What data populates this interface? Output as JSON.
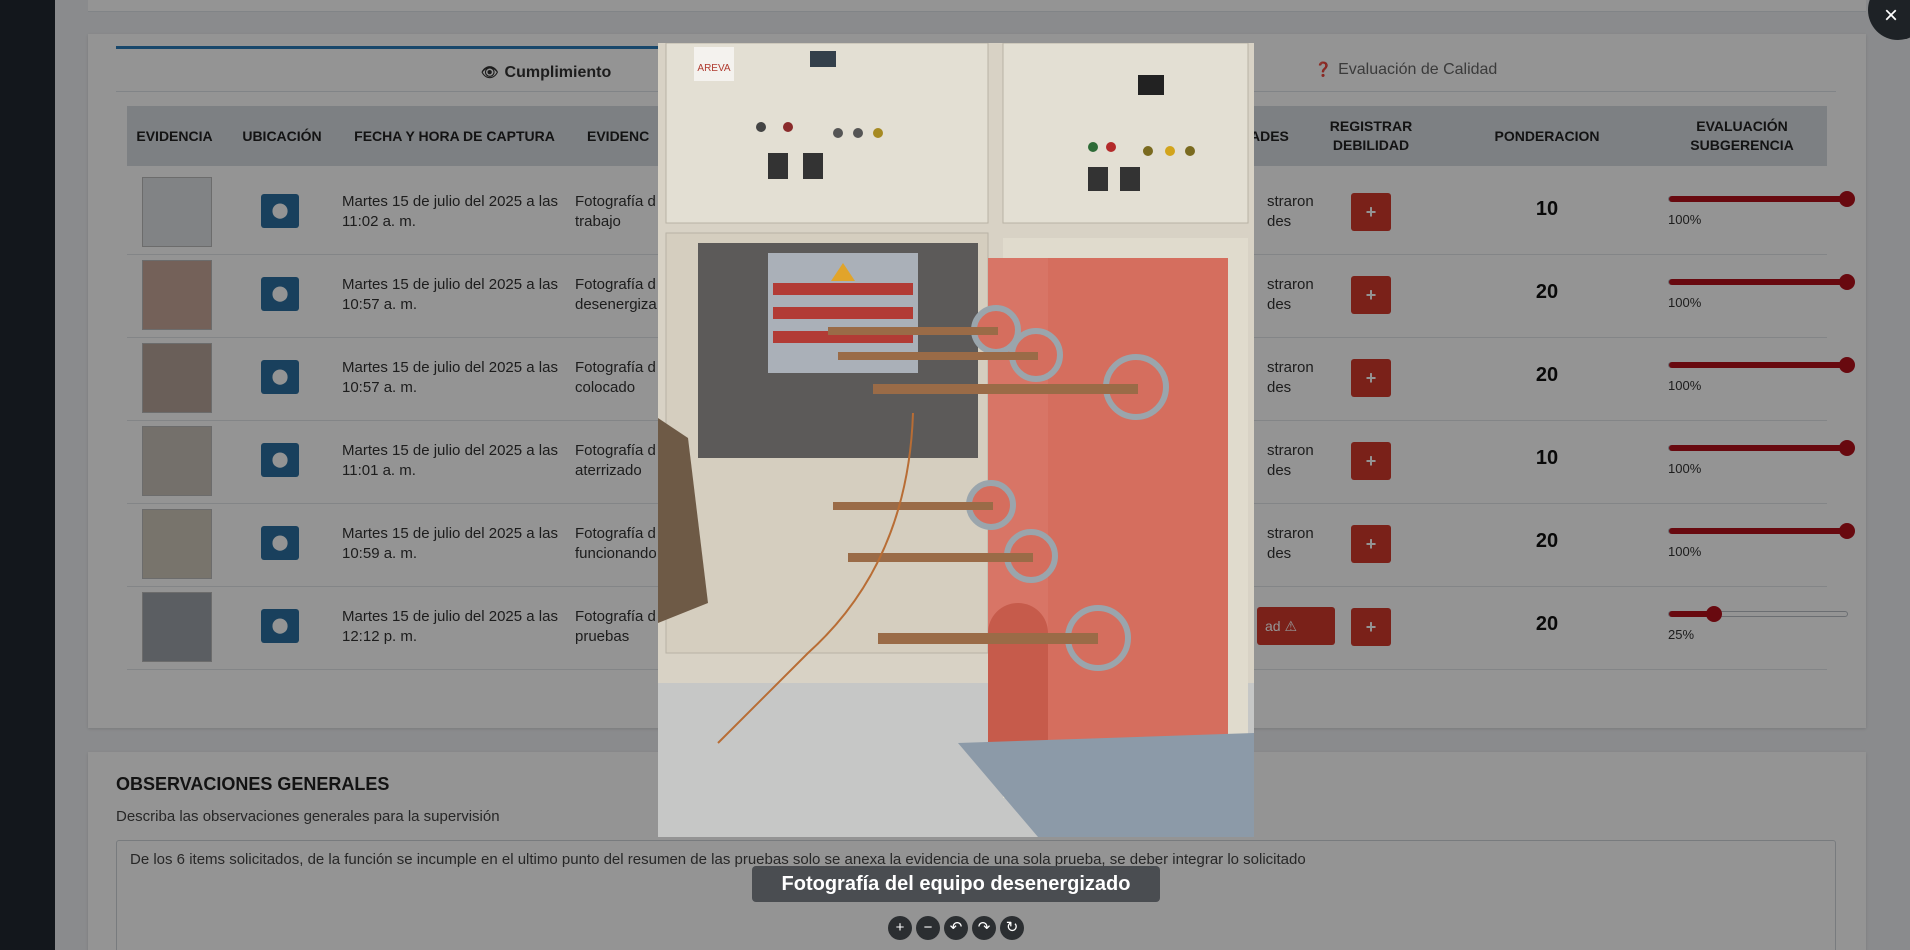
{
  "tabs": {
    "compliance": "Cumplimiento",
    "quality": "Evaluación de Calidad"
  },
  "table": {
    "headers": {
      "evidence": "EVIDENCIA",
      "location": "UBICACIÓN",
      "datetime": "FECHA Y HORA DE CAPTURA",
      "evidence_desc": "EVIDENC",
      "weaknesses": "ADES",
      "register": "REGISTRAR DEBILIDAD",
      "weight": "PONDERACION",
      "eval": "EVALUACIÓN SUBGERENCIA"
    },
    "rows": [
      {
        "date": "Martes 15 de julio del 2025 a las 11:02 a. m.",
        "desc1": "Fotografía d",
        "desc2": "trabajo",
        "cmt1": "straron",
        "cmt2": "des",
        "weight": "10",
        "value": 100,
        "pct": "100%"
      },
      {
        "date": "Martes 15 de julio del 2025 a las 10:57 a. m.",
        "desc1": "Fotografía d",
        "desc2": "desenergiza",
        "cmt1": "straron",
        "cmt2": "des",
        "weight": "20",
        "value": 100,
        "pct": "100%"
      },
      {
        "date": "Martes 15 de julio del 2025 a las 10:57 a. m.",
        "desc1": "Fotografía d",
        "desc2": "colocado",
        "cmt1": "straron",
        "cmt2": "des",
        "weight": "20",
        "value": 100,
        "pct": "100%"
      },
      {
        "date": "Martes 15 de julio del 2025 a las 11:01 a. m.",
        "desc1": "Fotografía d",
        "desc2": "aterrizado",
        "cmt1": "straron",
        "cmt2": "des",
        "weight": "10",
        "value": 100,
        "pct": "100%"
      },
      {
        "date": "Martes 15 de julio del 2025 a las 10:59 a. m.",
        "desc1": "Fotografía d",
        "desc2": "funcionando",
        "cmt1": "straron",
        "cmt2": "des",
        "weight": "20",
        "value": 100,
        "pct": "100%"
      },
      {
        "date": "Martes 15 de julio del 2025 a las 12:12 p. m.",
        "desc1": "Fotografía d",
        "desc2": "pruebas",
        "warn": "ad",
        "weight": "20",
        "value": 25,
        "pct": "25%"
      }
    ]
  },
  "observations": {
    "title": "OBSERVACIONES GENERALES",
    "subtitle": "Describa las observaciones generales para la supervisión",
    "text": "De los 6 items solicitados, de la función se incumple en el ultimo punto del resumen de las pruebas solo se anexa la evidencia de una sola prueba, se deber integrar lo solicitado"
  },
  "viewer": {
    "caption": "Fotografía del equipo desenergizado",
    "panel_brand": "AREVA",
    "close": "×",
    "controls": {
      "zoom_in": "+",
      "zoom_out": "−",
      "rotate_left": "↶",
      "rotate_right": "↷",
      "reset": "↻"
    }
  },
  "colors": {
    "accent": "#2a7ab8",
    "danger": "#d33a2c",
    "slider": "#b3111b",
    "location": "#2c6fa0"
  }
}
